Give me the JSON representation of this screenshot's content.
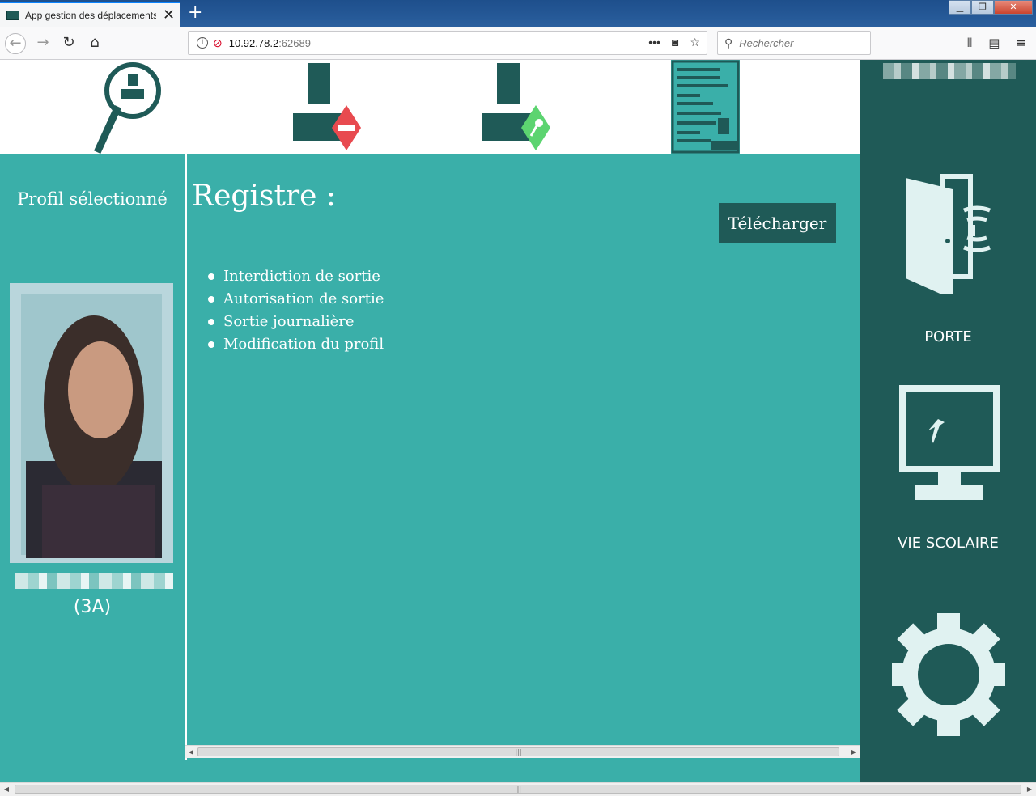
{
  "browser": {
    "tab_title": "App gestion des déplacements",
    "tab_close": "✕",
    "new_tab": "+",
    "url_host": "10.92.78.2",
    "url_port": ":62689",
    "url_actions": "•••",
    "search_placeholder": "Rechercher",
    "window_controls": {
      "minimize": "▁",
      "maximize": "❐",
      "close": "✕"
    }
  },
  "topbar": {
    "tools": [
      {
        "name": "search-profile",
        "icon": "magnifier-person-icon"
      },
      {
        "name": "exit-ban",
        "icon": "person-no-entry-icon",
        "badge_color": "#e84a4f"
      },
      {
        "name": "exit-authorization",
        "icon": "person-key-icon",
        "badge_color": "#5cd470"
      },
      {
        "name": "register",
        "icon": "document-list-icon",
        "active": true
      }
    ]
  },
  "sidebar": {
    "items": [
      {
        "label": "PORTE",
        "icon": "door-icon"
      },
      {
        "label": "VIE SCOLAIRE",
        "icon": "monitor-icon"
      },
      {
        "label": "",
        "icon": "gear-icon"
      }
    ]
  },
  "profile": {
    "heading": "Profil sélectionné",
    "class": "(3A)"
  },
  "main": {
    "title": "Registre :",
    "download_label": "Télécharger",
    "register_items": [
      "Interdiction de sortie",
      "Autorisation de sortie",
      "Sortie journalière",
      "Modification du profil"
    ]
  },
  "colors": {
    "primary_teal": "#3aafa9",
    "dark_teal": "#1f5a57",
    "ban_red": "#e84a4f",
    "auth_green": "#5cd470"
  }
}
